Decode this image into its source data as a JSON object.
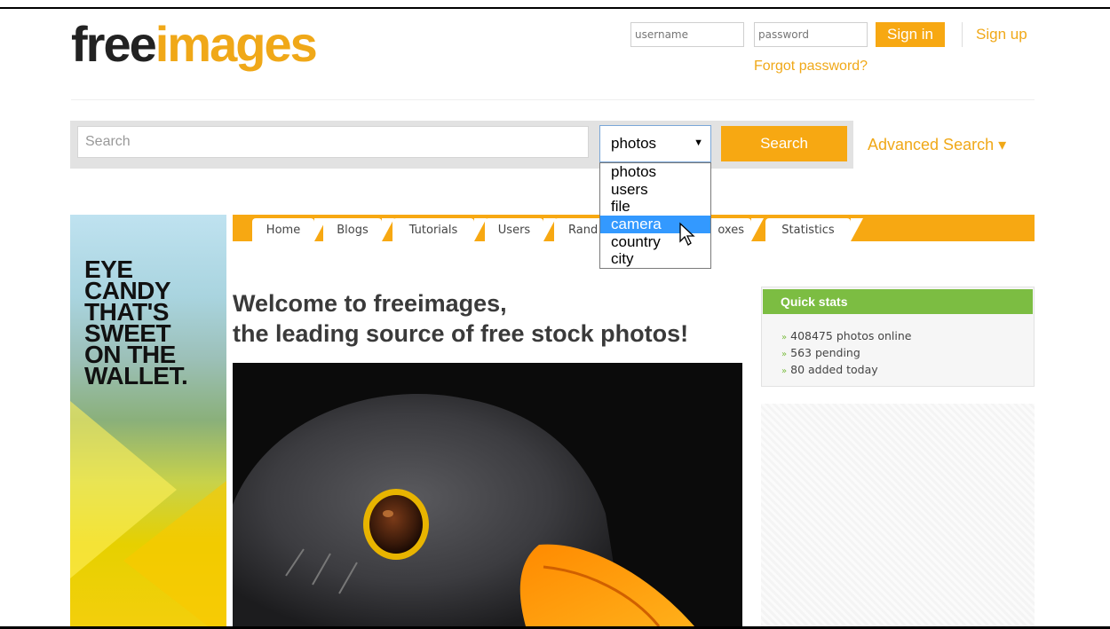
{
  "logo": {
    "part1": "free",
    "part2": "images"
  },
  "login": {
    "username_placeholder": "username",
    "password_placeholder": "password",
    "signin_label": "Sign in",
    "signup_label": "Sign up",
    "forgot_label": "Forgot password?"
  },
  "search": {
    "placeholder": "Search",
    "type_selected": "photos",
    "button_label": "Search",
    "advanced_label": "Advanced Search ▾",
    "options": [
      "photos",
      "users",
      "file",
      "camera",
      "country",
      "city"
    ],
    "highlighted_option": "camera"
  },
  "ad": {
    "lines": [
      "EYE",
      "CANDY",
      "THAT'S",
      "SWEET",
      "ON THE",
      "WALLET."
    ]
  },
  "nav": {
    "tabs": [
      "Home",
      "Blogs",
      "Tutorials",
      "Users",
      "Rand",
      "oxes",
      "Statistics"
    ]
  },
  "welcome": {
    "line1": "Welcome to freeimages,",
    "line2": "the leading source of free stock photos!"
  },
  "quick_stats": {
    "title": "Quick stats",
    "items": [
      "408475 photos online",
      "563 pending",
      "80 added today"
    ]
  },
  "colors": {
    "accent": "#f7a812",
    "stats_header": "#7cbd42",
    "selection": "#3399ff"
  }
}
